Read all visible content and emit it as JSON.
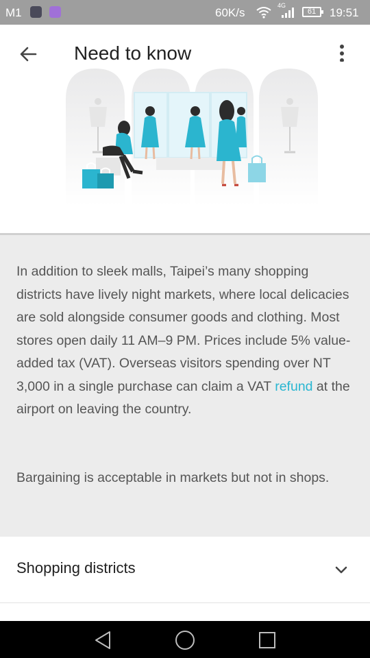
{
  "status_bar": {
    "carrier": "M1",
    "net_speed": "60K/s",
    "network_type": "4G",
    "battery": "61",
    "time": "19:51"
  },
  "header": {
    "title": "Need to know",
    "back_icon": "arrow-left-icon",
    "menu_icon": "more-vertical-icon"
  },
  "info": {
    "para1_text_before_link": "In addition to sleek malls, Taipei’s many shopping districts have lively night markets, where local delicacies are sold alongside consumer goods and clothing. Most stores open daily 11 AM–9 PM. Prices include 5% value-added tax (VAT). Overseas visitors spending over NT 3,000 in a single purchase can claim a VAT ",
    "para1_link": "refund",
    "para1_text_after_link": " at the airport on leaving the country.",
    "para2": "Bargaining is acceptable in markets but not in shops."
  },
  "accordion": {
    "label": "Shopping districts",
    "icon": "chevron-down-icon"
  },
  "colors": {
    "accent": "#29b6d1",
    "status_bar": "#9e9e9e",
    "info_bg": "#ececec",
    "dress": "#2bb5cf"
  }
}
